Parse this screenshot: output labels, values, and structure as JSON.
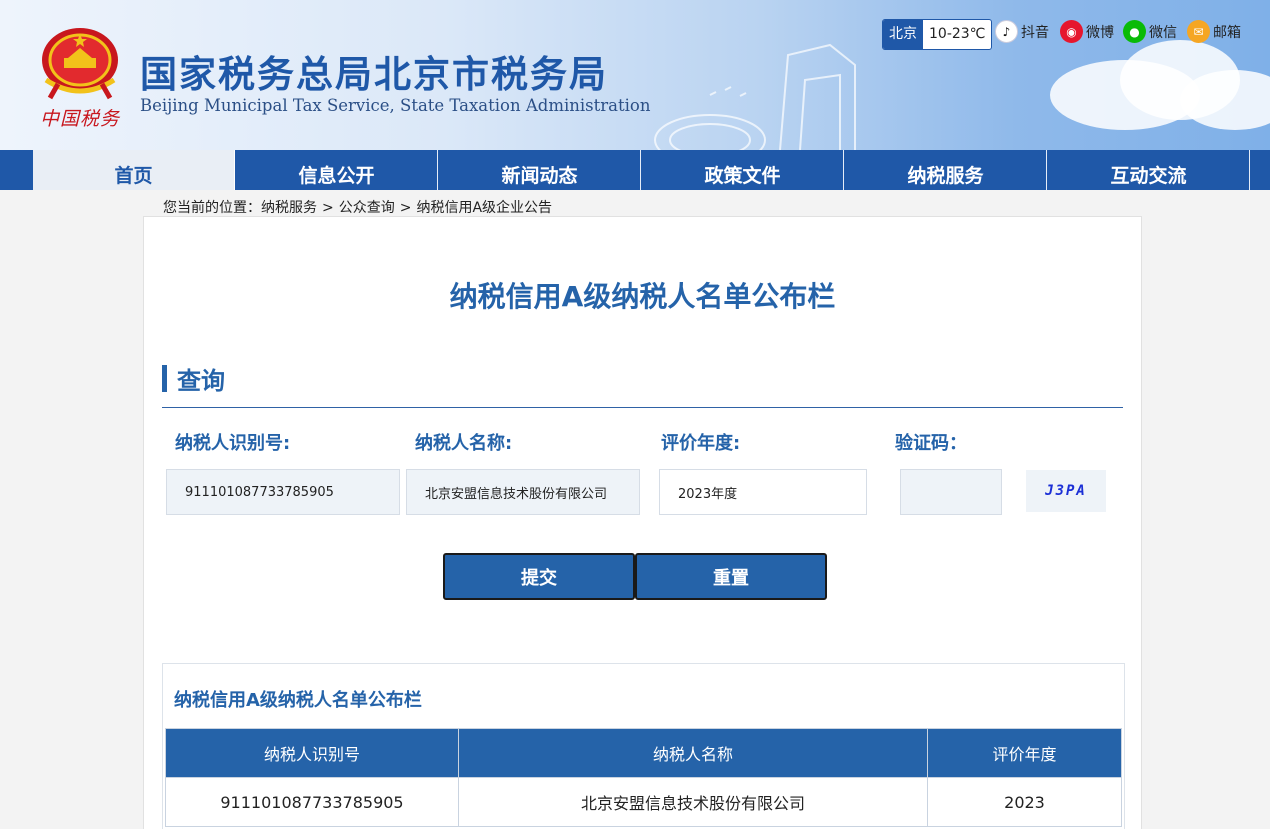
{
  "header": {
    "title": "国家税务总局北京市税务局",
    "subtitle": "Beijing Municipal Tax Service, State Taxation Administration",
    "seal_text": "中国税务",
    "weather": {
      "city": "北京",
      "temp": "10-23℃"
    },
    "social": [
      {
        "label": "抖音",
        "icon": "douyin-icon",
        "color": "#111111"
      },
      {
        "label": "微博",
        "icon": "weibo-icon",
        "color": "#e6162d"
      },
      {
        "label": "微信",
        "icon": "wechat-icon",
        "color": "#09bb07"
      },
      {
        "label": "邮箱",
        "icon": "mail-icon",
        "color": "#f5a623"
      }
    ]
  },
  "nav": {
    "items": [
      {
        "label": "首页",
        "active": true
      },
      {
        "label": "信息公开"
      },
      {
        "label": "新闻动态"
      },
      {
        "label": "政策文件"
      },
      {
        "label": "纳税服务"
      },
      {
        "label": "互动交流"
      }
    ]
  },
  "breadcrumb": {
    "prefix": "您当前的位置：",
    "items": [
      "纳税服务",
      "公众查询",
      "纳税信用A级企业公告"
    ],
    "separator": ">"
  },
  "main": {
    "title": "纳税信用A级纳税人名单公布栏",
    "section_label": "查询",
    "form": {
      "taxpayer_id_label": "纳税人识别号:",
      "taxpayer_id_value": "911101087733785905",
      "taxpayer_name_label": "纳税人名称:",
      "taxpayer_name_value": "北京安盟信息技术股份有限公司",
      "year_label": "评价年度:",
      "year_value": "2023年度",
      "captcha_label": "验证码：",
      "captcha_value": "",
      "captcha_image_text": "J3PA"
    },
    "buttons": {
      "submit": "提交",
      "reset": "重置"
    },
    "results": {
      "title": "纳税信用A级纳税人名单公布栏",
      "headers": [
        "纳税人识别号",
        "纳税人名称",
        "评价年度"
      ],
      "rows": [
        [
          "911101087733785905",
          "北京安盟信息技术股份有限公司",
          "2023"
        ]
      ]
    }
  },
  "colors": {
    "primary": "#1f58a8",
    "accent": "#2563a9",
    "seal_red": "#c8171e"
  }
}
